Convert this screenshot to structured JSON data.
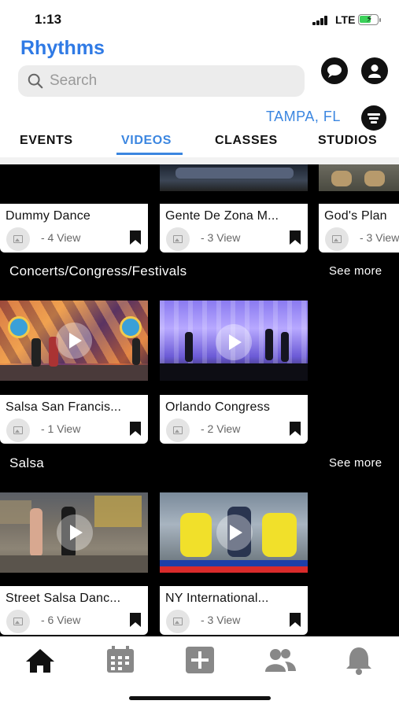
{
  "status_bar": {
    "time": "1:13",
    "network": "LTE"
  },
  "header": {
    "app_title": "Rhythms",
    "search_placeholder": "Search",
    "location": "TAMPA, FL"
  },
  "tabs": [
    {
      "label": "EVENTS",
      "active": false
    },
    {
      "label": "VIDEOS",
      "active": true
    },
    {
      "label": "CLASSES",
      "active": false
    },
    {
      "label": "STUDIOS",
      "active": false
    }
  ],
  "top_row": [
    {
      "title": "Dummy Dance",
      "views": "- 4 View"
    },
    {
      "title": "Gente De Zona M...",
      "views": "- 3 View"
    },
    {
      "title": "God's Plan",
      "views": "- 3 View"
    }
  ],
  "sections": [
    {
      "title": "Concerts/Congress/Festivals",
      "see_more": "See more",
      "videos": [
        {
          "title": "Salsa San Francis...",
          "views": "- 1 View"
        },
        {
          "title": "Orlando Congress",
          "views": "- 2 View"
        }
      ]
    },
    {
      "title": "Salsa",
      "see_more": "See more",
      "videos": [
        {
          "title": "Street Salsa Danc...",
          "views": "- 6 View"
        },
        {
          "title": "NY International...",
          "views": "- 3 View"
        }
      ]
    }
  ],
  "bottom_nav": [
    {
      "icon": "home-icon",
      "active": true
    },
    {
      "icon": "calendar-icon",
      "active": false
    },
    {
      "icon": "add-icon",
      "active": false
    },
    {
      "icon": "users-icon",
      "active": false
    },
    {
      "icon": "bell-icon",
      "active": false
    }
  ],
  "colors": {
    "accent": "#3b86e0",
    "brand": "#2f7ae5",
    "background_content": "#000000"
  }
}
